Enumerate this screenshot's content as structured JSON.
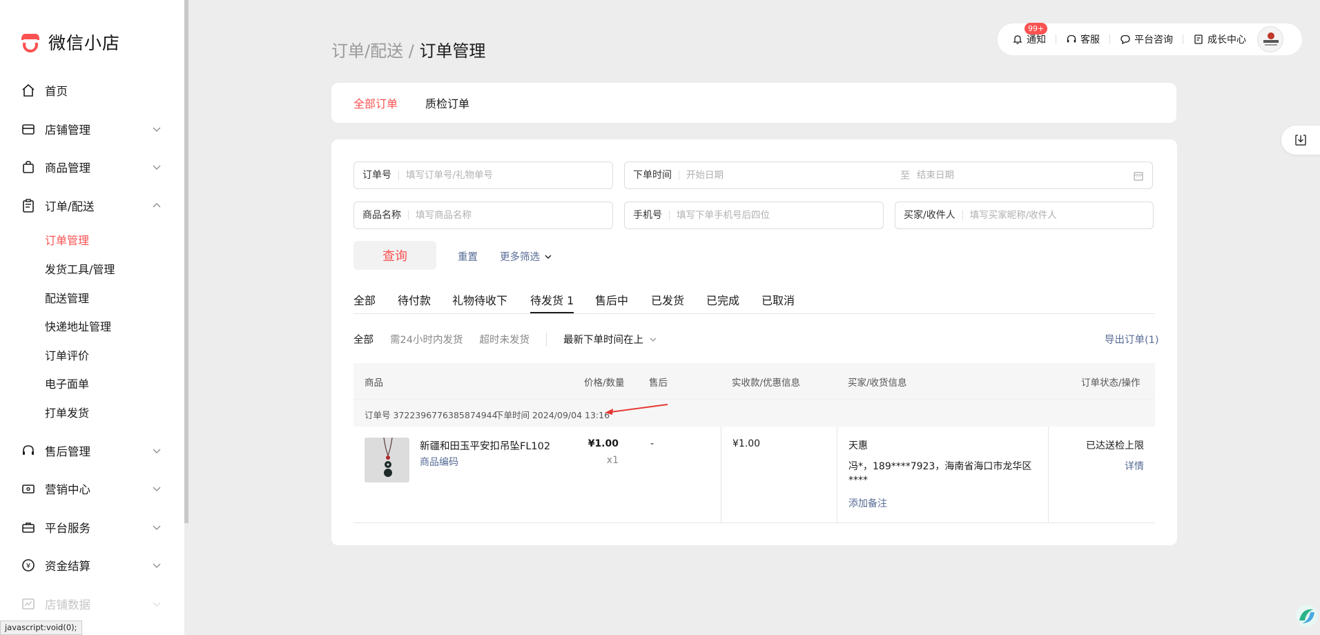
{
  "app": {
    "name": "微信小店"
  },
  "sidebar": {
    "items": [
      {
        "label": "首页"
      },
      {
        "label": "店铺管理"
      },
      {
        "label": "商品管理"
      },
      {
        "label": "订单/配送"
      },
      {
        "label": "售后管理"
      },
      {
        "label": "营销中心"
      },
      {
        "label": "平台服务"
      },
      {
        "label": "资金结算"
      },
      {
        "label": "店铺数据"
      }
    ],
    "sub_items": [
      {
        "label": "订单管理"
      },
      {
        "label": "发货工具/管理"
      },
      {
        "label": "配送管理"
      },
      {
        "label": "快递地址管理"
      },
      {
        "label": "订单评价"
      },
      {
        "label": "电子面单"
      },
      {
        "label": "打单发货"
      }
    ]
  },
  "breadcrumb": {
    "parent": "订单/配送",
    "sep": " / ",
    "current": "订单管理"
  },
  "toolbar": {
    "notify": "通知",
    "notify_badge": "99+",
    "service": "客服",
    "consult": "平台咨询",
    "growth": "成长中心"
  },
  "top_tabs": [
    "全部订单",
    "质检订单"
  ],
  "search": {
    "order_no_label": "订单号",
    "order_no_placeholder": "填写订单号/礼物单号",
    "time_label": "下单时间",
    "start_placeholder": "开始日期",
    "to": "至",
    "end_placeholder": "结束日期",
    "product_label": "商品名称",
    "product_placeholder": "填写商品名称",
    "phone_label": "手机号",
    "phone_placeholder": "填写下单手机号后四位",
    "buyer_label": "买家/收件人",
    "buyer_placeholder": "填写买家昵称/收件人",
    "query": "查询",
    "reset": "重置",
    "more": "更多筛选"
  },
  "status_tabs": [
    "全部",
    "待付款",
    "礼物待收下",
    "待发货 1",
    "售后中",
    "已发货",
    "已完成",
    "已取消"
  ],
  "filters": {
    "all": "全部",
    "within24": "需24小时内发货",
    "overdue": "超时未发货",
    "sort": "最新下单时间在上",
    "export": "导出订单(1)"
  },
  "table": {
    "headers": [
      "商品",
      "价格/数量",
      "售后",
      "实收款/优惠信息",
      "买家/收货信息",
      "订单状态/操作"
    ]
  },
  "order": {
    "order_no": "订单号 3722396776385874944",
    "order_time": "下单时间 2024/09/04 13:16",
    "product_name": "新疆和田玉平安扣吊坠FL102",
    "product_code": "商品编码",
    "price": "¥1.00",
    "qty": "x1",
    "after_sale": "-",
    "received": "¥1.00",
    "buyer": "天惠",
    "address": "冯*，189****7923，海南省海口市龙华区",
    "address2": "****",
    "add_note": "添加备注",
    "status": "已达送检上限",
    "detail": "详情"
  },
  "browser_status": "javascript:void(0);",
  "colors": {
    "accent": "#fa5151",
    "link": "#576b95"
  }
}
